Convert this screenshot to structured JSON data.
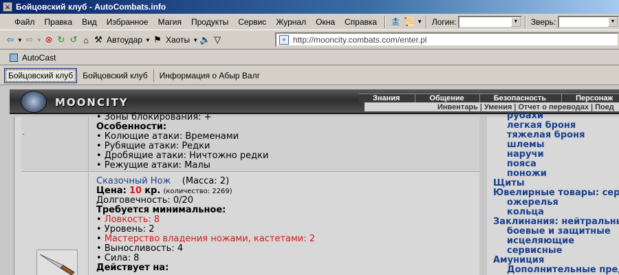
{
  "window": {
    "title": "Бойцовский клуб - AutoCombats.info"
  },
  "menu": {
    "items": [
      "Файл",
      "Правка",
      "Вид",
      "Избранное",
      "Магия",
      "Продукты",
      "Сервис",
      "Журнал",
      "Окна",
      "Справка"
    ],
    "login_label": "Логин:",
    "pet_label": "Зверь:",
    "login_value": "",
    "pet_value": ""
  },
  "toolbar": {
    "autostrike_label": "Автоудар",
    "chaos_label": "Хаоты",
    "address": "http://mooncity.combats.com/enter.pl"
  },
  "autocast": {
    "label": "AutoCast"
  },
  "tabs": [
    "Бойцовский клуб",
    "Бойцовский клуб",
    "Информация о Абыр Валг"
  ],
  "site": {
    "logo": "MOONCITY",
    "topnav": [
      "Знания",
      "Общение",
      "Безопасность",
      "Персонаж"
    ],
    "subnav": [
      "Инвентарь",
      "Умения",
      "Отчет о переводах",
      "Поед"
    ]
  },
  "prev_item": {
    "lines": [
      "• Зоны блокирования: +",
      "Особенности:",
      "• Колющие атаки: Временами",
      "• Рубящие атаки: Редки",
      "• Дробящие атаки: Ничтожно редки",
      "• Режущие атаки: Малы"
    ]
  },
  "item": {
    "name": "Сказочный Нож",
    "mass": "(Масса: 2)",
    "price_label": "Цена:",
    "price_value": "10",
    "price_unit": "кр.",
    "quantity": "(количество: 2269)",
    "durability": "Долговечность: 0/20",
    "req_title": "Требуется минимальное:",
    "req_dex": "Ловкость: 8",
    "req_level": "• Уровень: 2",
    "req_skill": "Мастерство владения ножами, кастетами: 2",
    "req_endurance": "• Выносливость: 4",
    "req_strength": "• Сила: 8",
    "acts_on": "Действует на:"
  },
  "sidebar": {
    "items": [
      {
        "label": "рубахи",
        "indent": true
      },
      {
        "label": "легкая броня",
        "indent": true
      },
      {
        "label": "тяжелая броня",
        "indent": true
      },
      {
        "label": "шлемы",
        "indent": true
      },
      {
        "label": "наручи",
        "indent": true
      },
      {
        "label": "пояса",
        "indent": true
      },
      {
        "label": "поножи",
        "indent": true
      },
      {
        "label": "Щиты",
        "indent": false
      },
      {
        "label": "Ювелирные товары: серьги",
        "indent": false
      },
      {
        "label": "ожерелья",
        "indent": true
      },
      {
        "label": "кольца",
        "indent": true
      },
      {
        "label": "Заклинания: нейтральные",
        "indent": false
      },
      {
        "label": "боевые и защитные",
        "indent": true
      },
      {
        "label": "исцеляющие",
        "indent": true
      },
      {
        "label": "сервисные",
        "indent": true
      },
      {
        "label": "Амуниция",
        "indent": false
      },
      {
        "label": "Дополнительные предм",
        "indent": true
      }
    ]
  }
}
